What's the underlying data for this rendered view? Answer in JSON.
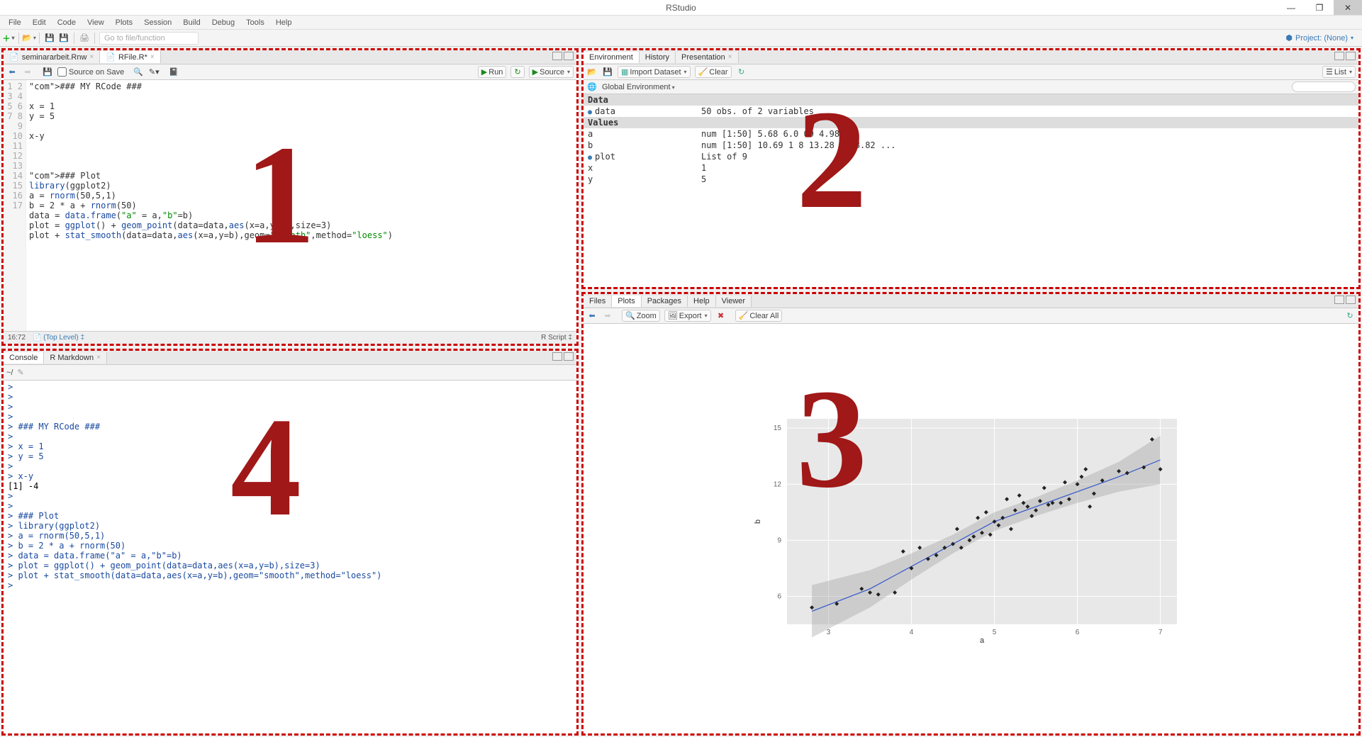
{
  "window": {
    "title": "RStudio"
  },
  "menubar": [
    "File",
    "Edit",
    "Code",
    "View",
    "Plots",
    "Session",
    "Build",
    "Debug",
    "Tools",
    "Help"
  ],
  "toolbar": {
    "gotofile": "Go to file/function",
    "project": "Project: (None)"
  },
  "overlays": {
    "p1": "1",
    "p2": "2",
    "p3": "3",
    "p4": "4"
  },
  "source": {
    "tabs": [
      {
        "label": "seminararbeit.Rnw",
        "active": false
      },
      {
        "label": "RFile.R*",
        "active": true,
        "red": true
      }
    ],
    "tb": {
      "sourceOnSave": "Source on Save",
      "run": "Run",
      "source": "Source"
    },
    "lines": [
      "### MY RCode ###",
      "",
      "x = 1",
      "y = 5",
      "",
      "x-y",
      "",
      "",
      "",
      "### Plot",
      "library(ggplot2)",
      "a = rnorm(50,5,1)",
      "b = 2 * a + rnorm(50)",
      "data = data.frame(\"a\" = a,\"b\"=b)",
      "plot = ggplot() + geom_point(data=data,aes(x=a,y=b),size=3)",
      "plot + stat_smooth(data=data,aes(x=a,y=b),geom=\"smooth\",method=\"loess\")",
      ""
    ],
    "status": {
      "pos": "16:72",
      "scope": "(Top Level)",
      "type": "R Script"
    }
  },
  "consolepane": {
    "tabs": [
      "Console",
      "R Markdown"
    ],
    "path": "~/",
    "lines": [
      {
        "p": ">",
        "t": ""
      },
      {
        "p": ">",
        "t": ""
      },
      {
        "p": ">",
        "t": ""
      },
      {
        "p": ">",
        "t": ""
      },
      {
        "p": ">",
        "t": "### MY RCode ###"
      },
      {
        "p": ">",
        "t": ""
      },
      {
        "p": ">",
        "t": "x = 1"
      },
      {
        "p": ">",
        "t": "y = 5"
      },
      {
        "p": ">",
        "t": ""
      },
      {
        "p": ">",
        "t": "x-y"
      },
      {
        "out": true,
        "t": "[1] -4"
      },
      {
        "p": ">",
        "t": ""
      },
      {
        "p": ">",
        "t": ""
      },
      {
        "p": ">",
        "t": "### Plot"
      },
      {
        "p": ">",
        "t": "library(ggplot2)"
      },
      {
        "p": ">",
        "t": "a = rnorm(50,5,1)"
      },
      {
        "p": ">",
        "t": "b = 2 * a + rnorm(50)"
      },
      {
        "p": ">",
        "t": "data = data.frame(\"a\" = a,\"b\"=b)"
      },
      {
        "p": ">",
        "t": "plot = ggplot() + geom_point(data=data,aes(x=a,y=b),size=3)"
      },
      {
        "p": ">",
        "t": "plot + stat_smooth(data=data,aes(x=a,y=b),geom=\"smooth\",method=\"loess\")"
      },
      {
        "p": ">",
        "t": ""
      }
    ]
  },
  "env": {
    "tabs": [
      "Environment",
      "History",
      "Presentation"
    ],
    "tb": {
      "import": "Import Dataset",
      "clear": "Clear",
      "list": "List",
      "scope": "Global Environment"
    },
    "sections": [
      {
        "hdr": "Data",
        "rows": [
          {
            "name": "data",
            "val": "50 obs. of 2 variables",
            "circ": true
          }
        ]
      },
      {
        "hdr": "Values",
        "rows": [
          {
            "name": "a",
            "val": "num [1:50] 5.68 6.0   09     4.98 ..."
          },
          {
            "name": "b",
            "val": "num [1:50] 10.69 1   8 13.28   69 8.82 ..."
          },
          {
            "name": "plot",
            "val": "List of 9",
            "circ": true
          },
          {
            "name": "x",
            "val": "1"
          },
          {
            "name": "y",
            "val": "5"
          }
        ]
      }
    ]
  },
  "plots": {
    "tabs": [
      "Files",
      "Plots",
      "Packages",
      "Help",
      "Viewer"
    ],
    "tb": {
      "zoom": "Zoom",
      "export": "Export",
      "clear": "Clear All"
    }
  },
  "chart_data": {
    "type": "scatter",
    "xlabel": "a",
    "ylabel": "b",
    "xlim": [
      2.5,
      7.2
    ],
    "ylim": [
      4.5,
      15.5
    ],
    "xticks": [
      3,
      4,
      5,
      6,
      7
    ],
    "yticks": [
      6,
      9,
      12,
      15
    ],
    "series": [
      {
        "name": "points",
        "type": "scatter",
        "x": [
          2.8,
          3.1,
          3.4,
          3.5,
          3.6,
          3.8,
          3.9,
          4.0,
          4.1,
          4.2,
          4.3,
          4.4,
          4.5,
          4.55,
          4.6,
          4.7,
          4.75,
          4.8,
          4.85,
          4.9,
          4.95,
          5.0,
          5.05,
          5.1,
          5.15,
          5.2,
          5.25,
          5.3,
          5.35,
          5.4,
          5.45,
          5.5,
          5.55,
          5.6,
          5.65,
          5.7,
          5.8,
          5.85,
          5.9,
          6.0,
          6.05,
          6.1,
          6.15,
          6.2,
          6.3,
          6.5,
          6.6,
          6.8,
          6.9,
          7.0
        ],
        "y": [
          5.4,
          5.6,
          6.4,
          6.2,
          6.1,
          6.2,
          8.4,
          7.5,
          8.6,
          8.0,
          8.2,
          8.6,
          8.8,
          9.6,
          8.6,
          9.0,
          9.2,
          10.2,
          9.4,
          10.5,
          9.3,
          10.0,
          9.8,
          10.2,
          11.2,
          9.6,
          10.6,
          11.4,
          11.0,
          10.8,
          10.3,
          10.6,
          11.1,
          11.8,
          10.9,
          11.0,
          11.0,
          12.1,
          11.2,
          12.0,
          12.4,
          12.8,
          10.8,
          11.5,
          12.2,
          12.7,
          12.6,
          12.9,
          14.4,
          12.8
        ]
      },
      {
        "name": "loess",
        "type": "line",
        "x": [
          2.8,
          3.5,
          4.0,
          4.5,
          5.0,
          5.5,
          6.0,
          6.5,
          7.0
        ],
        "y": [
          5.2,
          6.4,
          7.6,
          8.8,
          10.0,
          10.8,
          11.6,
          12.4,
          13.3
        ]
      }
    ],
    "ribbon": {
      "x": [
        2.8,
        3.5,
        4.0,
        4.5,
        5.0,
        5.5,
        6.0,
        6.5,
        7.0
      ],
      "lo": [
        3.8,
        5.4,
        6.9,
        8.3,
        9.5,
        10.3,
        11.0,
        11.6,
        12.0
      ],
      "hi": [
        6.6,
        7.4,
        8.3,
        9.3,
        10.5,
        11.3,
        12.2,
        13.2,
        14.6
      ]
    }
  }
}
